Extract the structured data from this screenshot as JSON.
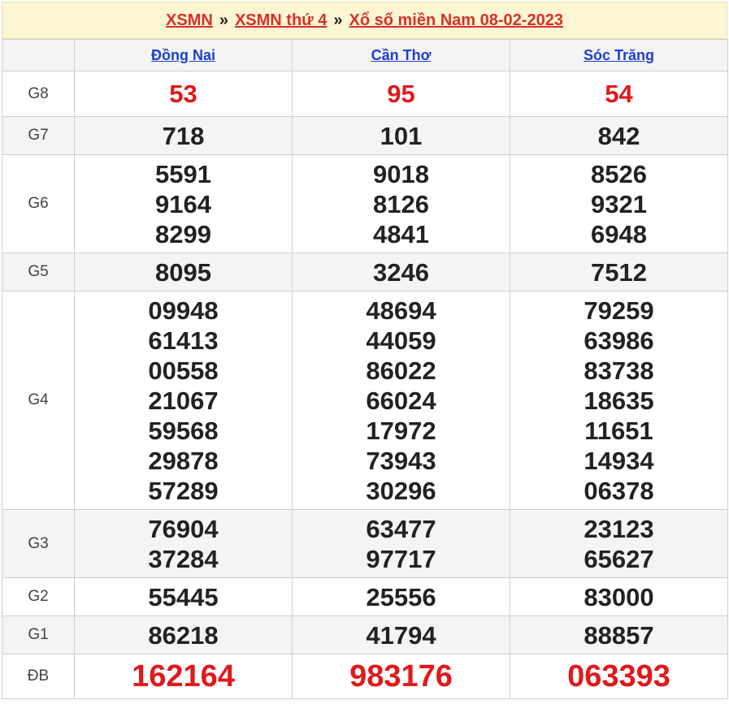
{
  "breadcrumb": {
    "home": "XSMN",
    "sep1": "»",
    "day": "XSMN thứ 4",
    "sep2": "»",
    "current": "Xổ số miền Nam 08-02-2023"
  },
  "provinces": [
    "Đồng Nai",
    "Cần Thơ",
    "Sóc Trăng"
  ],
  "prizes": [
    {
      "label": "G8",
      "style": "red",
      "values": [
        [
          "53"
        ],
        [
          "95"
        ],
        [
          "54"
        ]
      ]
    },
    {
      "label": "G7",
      "style": "normal",
      "values": [
        [
          "718"
        ],
        [
          "101"
        ],
        [
          "842"
        ]
      ]
    },
    {
      "label": "G6",
      "style": "normal",
      "values": [
        [
          "5591",
          "9164",
          "8299"
        ],
        [
          "9018",
          "8126",
          "4841"
        ],
        [
          "8526",
          "9321",
          "6948"
        ]
      ]
    },
    {
      "label": "G5",
      "style": "normal",
      "values": [
        [
          "8095"
        ],
        [
          "3246"
        ],
        [
          "7512"
        ]
      ]
    },
    {
      "label": "G4",
      "style": "normal",
      "values": [
        [
          "09948",
          "61413",
          "00558",
          "21067",
          "59568",
          "29878",
          "57289"
        ],
        [
          "48694",
          "44059",
          "86022",
          "66024",
          "17972",
          "73943",
          "30296"
        ],
        [
          "79259",
          "63986",
          "83738",
          "18635",
          "11651",
          "14934",
          "06378"
        ]
      ]
    },
    {
      "label": "G3",
      "style": "normal",
      "values": [
        [
          "76904",
          "37284"
        ],
        [
          "63477",
          "97717"
        ],
        [
          "23123",
          "65627"
        ]
      ]
    },
    {
      "label": "G2",
      "style": "normal",
      "values": [
        [
          "55445"
        ],
        [
          "25556"
        ],
        [
          "83000"
        ]
      ]
    },
    {
      "label": "G1",
      "style": "normal",
      "values": [
        [
          "86218"
        ],
        [
          "41794"
        ],
        [
          "88857"
        ]
      ]
    },
    {
      "label": "ĐB",
      "style": "red-big",
      "values": [
        [
          "162164"
        ],
        [
          "983176"
        ],
        [
          "063393"
        ]
      ]
    }
  ],
  "colors": {
    "link_red": "#d8302b",
    "province_link": "#1a3fd1",
    "prize_red": "#e0191c",
    "title_bg": "#fdf6d3",
    "alt_row": "#f4f4f4"
  }
}
